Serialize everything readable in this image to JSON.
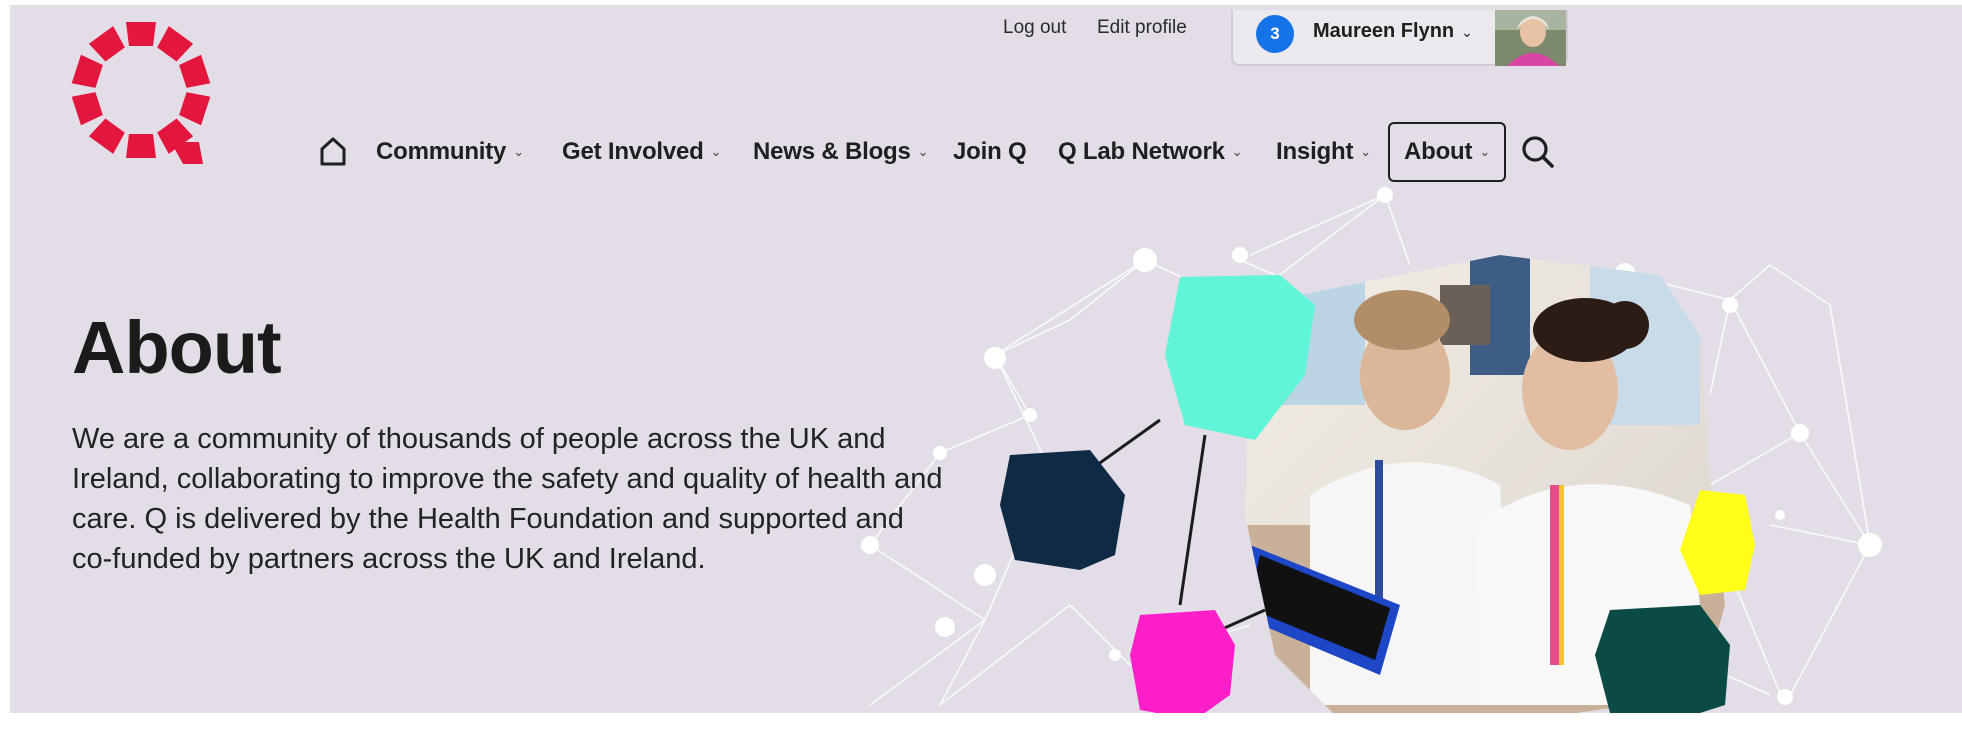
{
  "utility": {
    "logout": "Log out",
    "edit_profile": "Edit profile",
    "notification_count": "3",
    "user_name": "Maureen Flynn",
    "user_caret": "⌄"
  },
  "nav": {
    "items": [
      {
        "label": "Community",
        "caret": "⌄"
      },
      {
        "label": "Get Involved",
        "caret": "⌄"
      },
      {
        "label": "News & Blogs",
        "caret": "⌄"
      },
      {
        "label": "Join Q",
        "caret": ""
      },
      {
        "label": "Q Lab Network",
        "caret": "⌄"
      },
      {
        "label": "Insight",
        "caret": "⌄"
      },
      {
        "label": "About",
        "caret": "⌄"
      }
    ],
    "active": "About"
  },
  "hero": {
    "title": "About",
    "intro": "We are a community of thousands of people across the UK and Ireland, collaborating to improve the safety and quality of health and care. Q is delivered by the Health Foundation and supported and co-funded by partners across the UK and Ireland."
  },
  "icons": {
    "logo": "q-community-logo",
    "home": "home-icon",
    "search": "search-icon",
    "avatar": "user-avatar",
    "hero_image": "nurses-with-tablet-photo"
  },
  "colors": {
    "hero_bg": "#e2dde6",
    "brand_red": "#e3173e",
    "badge_blue": "#1473e6",
    "mint": "#5ff5d6",
    "navy": "#0e2a45",
    "magenta": "#ff1fc9",
    "yellow": "#ffff1a",
    "dark_teal": "#0b4b45"
  }
}
